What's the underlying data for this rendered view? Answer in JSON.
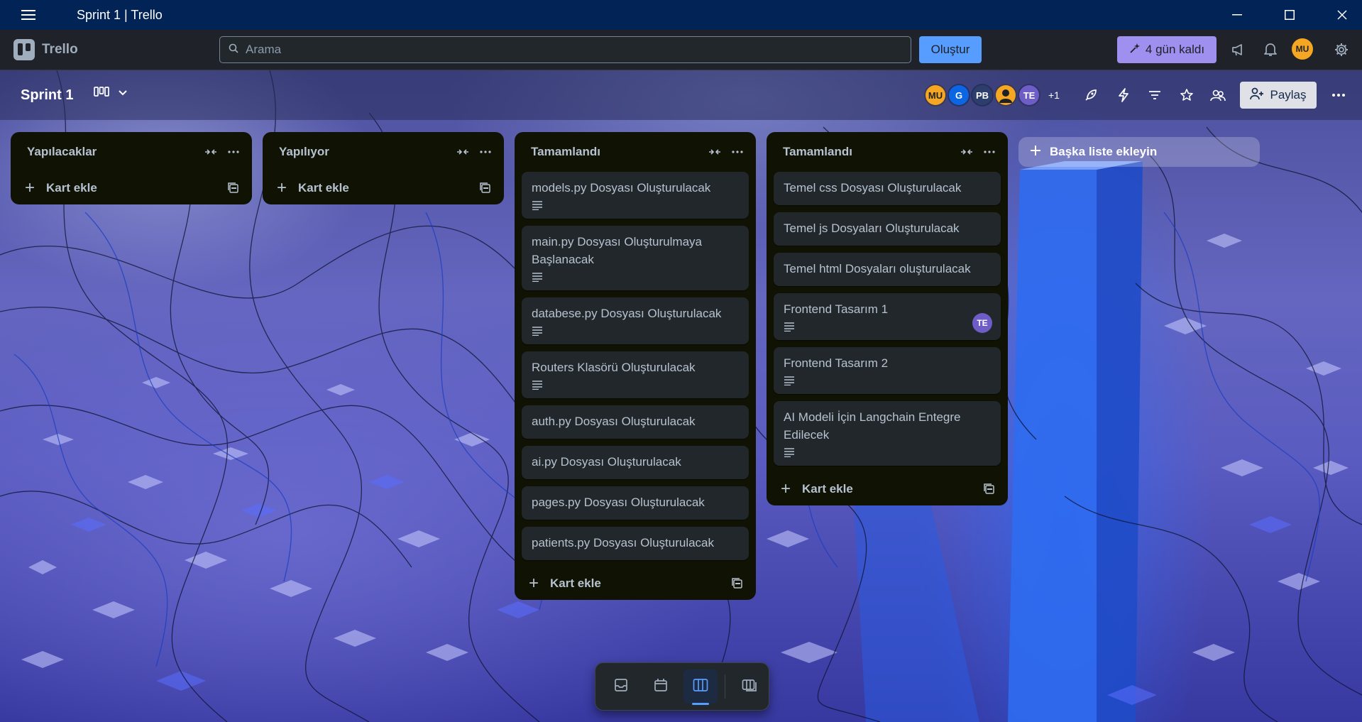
{
  "window": {
    "title": "Sprint 1 | Trello"
  },
  "header": {
    "logo_text": "Trello",
    "search_placeholder": "Arama",
    "create_label": "Oluştur",
    "trial_label": "4 gün kaldı",
    "user_initials": "MU"
  },
  "board": {
    "title": "Sprint 1",
    "members": [
      {
        "initials": "MU",
        "color": "#f5a623"
      },
      {
        "initials": "G",
        "color": "#0c66e4"
      },
      {
        "initials": "PB",
        "color": "#2c3e6b"
      },
      {
        "initials": "",
        "color": "#f5a623"
      },
      {
        "initials": "TE",
        "color": "#6e5dc6"
      }
    ],
    "members_more": "+1",
    "share_label": "Paylaş"
  },
  "lists": [
    {
      "title": "Yapılacaklar",
      "add_card_label": "Kart ekle",
      "cards": []
    },
    {
      "title": "Yapılıyor",
      "add_card_label": "Kart ekle",
      "cards": []
    },
    {
      "title": "Tamamlandı",
      "add_card_label": "Kart ekle",
      "cards": [
        {
          "title": "models.py Dosyası Oluşturulacak",
          "has_description": true
        },
        {
          "title": "main.py Dosyası Oluşturulmaya Başlanacak",
          "has_description": true
        },
        {
          "title": "databese.py Dosyası Oluşturulacak",
          "has_description": true
        },
        {
          "title": "Routers Klasörü Oluşturulacak",
          "has_description": true
        },
        {
          "title": "auth.py Dosyası Oluşturulacak",
          "has_description": false
        },
        {
          "title": "ai.py Dosyası Oluşturulacak",
          "has_description": false
        },
        {
          "title": "pages.py Dosyası Oluşturulacak",
          "has_description": false
        },
        {
          "title": "patients.py Dosyası Oluşturulacak",
          "has_description": false
        }
      ]
    },
    {
      "title": "Tamamlandı",
      "add_card_label": "Kart ekle",
      "cards": [
        {
          "title": "Temel css Dosyası Oluşturulacak",
          "has_description": false
        },
        {
          "title": "Temel js Dosyaları Oluşturulacak",
          "has_description": false
        },
        {
          "title": "Temel html Dosyaları oluşturulacak",
          "has_description": false
        },
        {
          "title": "Frontend Tasarım 1",
          "has_description": true,
          "member": "TE"
        },
        {
          "title": "Frontend Tasarım 2",
          "has_description": true
        },
        {
          "title": "AI Modeli İçin Langchain Entegre Edilecek",
          "has_description": true
        }
      ]
    }
  ],
  "add_list_label": "Başka liste ekleyin",
  "bottom_nav": {
    "items": [
      "inbox-icon",
      "calendar-icon",
      "board-icon",
      "switch-boards-icon"
    ],
    "active": "board-icon"
  }
}
